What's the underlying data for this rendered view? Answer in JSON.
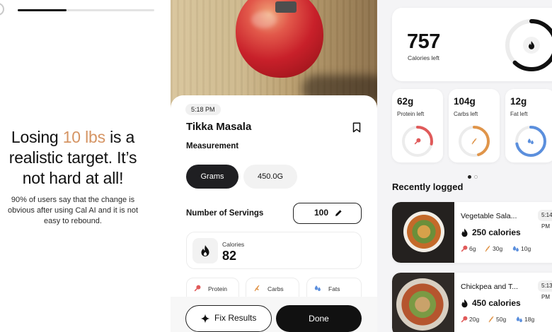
{
  "colors": {
    "accent": "#d59463",
    "protein": "#e05a5a",
    "carbs": "#e0954a",
    "fats": "#5b8fdd",
    "dark": "#111111"
  },
  "onboarding": {
    "progress_fraction": 0.36,
    "headline_pre": "Losing ",
    "headline_accent": "10 lbs",
    "headline_post": " is a realistic target. It’s not hard at all!",
    "subtext": "90% of users say that the change is obvious after using Cal AI and it is not easy to rebound."
  },
  "scan": {
    "time": "5:18 PM",
    "food_name": "Tikka Masala",
    "measurement_label": "Measurement",
    "unit_selected": "Grams",
    "unit_value": "450.0G",
    "servings_label": "Number of Servings",
    "servings_value": "100",
    "calories_label": "Calories",
    "calories_value": "82",
    "macros": [
      {
        "label": "Protein",
        "icon": "drumstick-icon"
      },
      {
        "label": "Carbs",
        "icon": "wheat-icon"
      },
      {
        "label": "Fats",
        "icon": "droplets-icon"
      }
    ],
    "fix_label": "Fix Results",
    "done_label": "Done"
  },
  "dashboard": {
    "calories_left_value": "757",
    "calories_left_label": "Calories left",
    "calories_ring_fraction": 0.62,
    "macro_cards": [
      {
        "value": "62g",
        "label": "Protein left",
        "fraction": 0.28,
        "icon": "drumstick-icon"
      },
      {
        "value": "104g",
        "label": "Carbs left",
        "fraction": 0.45,
        "icon": "wheat-icon"
      },
      {
        "value": "12g",
        "label": "Fat left",
        "fraction": 0.72,
        "icon": "droplets-icon"
      }
    ],
    "section_title": "Recently logged",
    "entries": [
      {
        "name": "Vegetable Sala...",
        "time": "5:14 PM",
        "calories": "250 calories",
        "protein": "6g",
        "carbs": "30g",
        "fats": "10g"
      },
      {
        "name": "Chickpea and T...",
        "time": "5:13 PM",
        "calories": "450 calories",
        "protein": "20g",
        "carbs": "50g",
        "fats": "18g"
      }
    ]
  }
}
